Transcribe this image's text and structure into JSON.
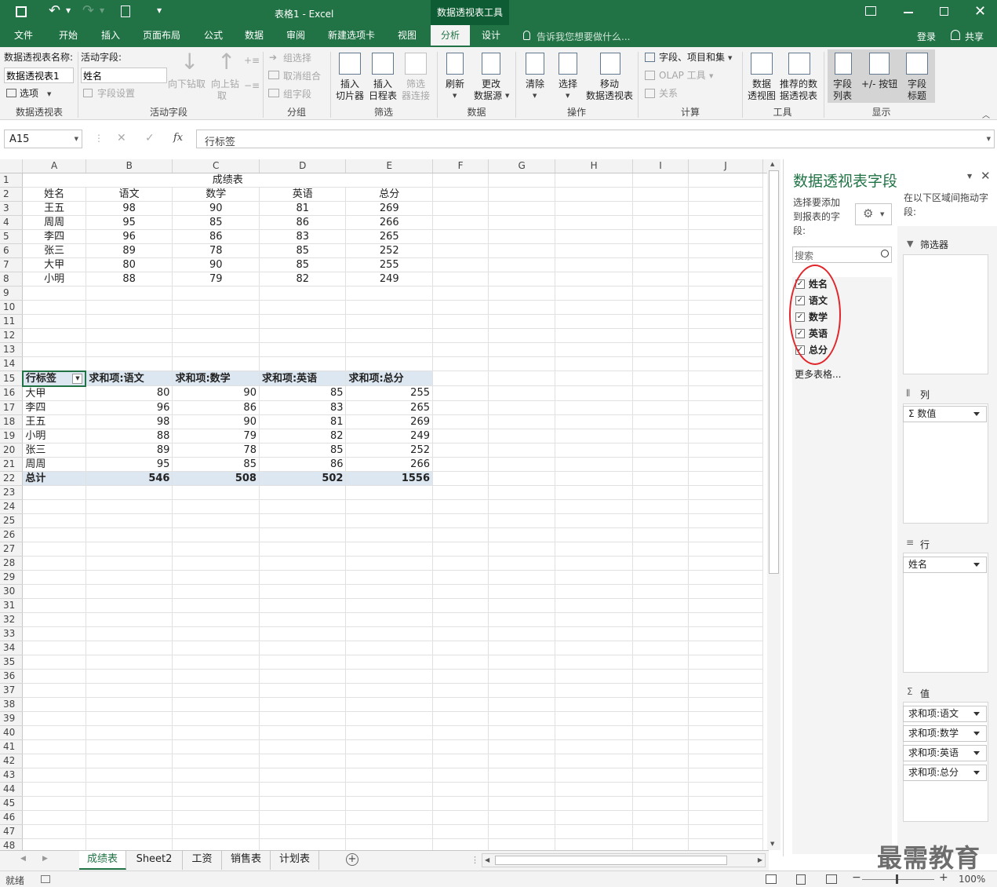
{
  "title": {
    "doc": "表格1 - Excel",
    "context_tool": "数据透视表工具"
  },
  "tabs": [
    "文件",
    "开始",
    "插入",
    "页面布局",
    "公式",
    "数据",
    "审阅",
    "新建选项卡",
    "视图",
    "分析",
    "设计"
  ],
  "tellme": "告诉我您想要做什么...",
  "login": "登录",
  "share": "共享",
  "ribbon": {
    "pt_name_label": "数据透视表名称:",
    "pt_name_value": "数据透视表1",
    "options": "选项",
    "active_field_label": "活动字段:",
    "active_field_value": "姓名",
    "field_settings": "字段设置",
    "drill_down": "向下钻取",
    "drill_up": "向上钻",
    "drill_up2": "取",
    "group_select": "组选择",
    "ungroup": "取消组合",
    "group_field": "组字段",
    "insert_slicer": [
      "插入",
      "切片器"
    ],
    "insert_timeline": [
      "插入",
      "日程表"
    ],
    "filter_conn": [
      "筛选",
      "器连接"
    ],
    "refresh": "刷新",
    "change_source": [
      "更改",
      "数据源"
    ],
    "clear": "清除",
    "select": "选择",
    "move_pt": [
      "移动",
      "数据透视表"
    ],
    "fields_items_sets": "字段、项目和集",
    "olap_tools": "OLAP 工具",
    "relationships": "关系",
    "pivotchart": [
      "数据",
      "透视图"
    ],
    "recommended_pt": [
      "推荐的数",
      "据透视表"
    ],
    "field_list": [
      "字段",
      "列表"
    ],
    "plus_minus_buttons": "+/- 按钮",
    "field_headers": [
      "字段",
      "标题"
    ],
    "groups": {
      "pivot_table": "数据透视表",
      "active_field": "活动字段",
      "group": "分组",
      "filter": "筛选",
      "data": "数据",
      "actions": "操作",
      "calculations": "计算",
      "tools": "工具",
      "show": "显示"
    }
  },
  "formula_bar": {
    "name_box": "A15",
    "content": "行标签"
  },
  "columns": [
    "A",
    "B",
    "C",
    "D",
    "E",
    "F",
    "G",
    "H",
    "I",
    "J"
  ],
  "source_table": {
    "title": "成绩表",
    "headers": [
      "姓名",
      "语文",
      "数学",
      "英语",
      "总分"
    ],
    "rows": [
      [
        "王五",
        "98",
        "90",
        "81",
        "269"
      ],
      [
        "周周",
        "95",
        "85",
        "86",
        "266"
      ],
      [
        "李四",
        "96",
        "86",
        "83",
        "265"
      ],
      [
        "张三",
        "89",
        "78",
        "85",
        "252"
      ],
      [
        "大甲",
        "80",
        "90",
        "85",
        "255"
      ],
      [
        "小明",
        "88",
        "79",
        "82",
        "249"
      ]
    ]
  },
  "pivot": {
    "headers": [
      "行标签",
      "求和项:语文",
      "求和项:数学",
      "求和项:英语",
      "求和项:总分"
    ],
    "rows": [
      [
        "大甲",
        "80",
        "90",
        "85",
        "255"
      ],
      [
        "李四",
        "96",
        "86",
        "83",
        "265"
      ],
      [
        "王五",
        "98",
        "90",
        "81",
        "269"
      ],
      [
        "小明",
        "88",
        "79",
        "82",
        "249"
      ],
      [
        "张三",
        "89",
        "78",
        "85",
        "252"
      ],
      [
        "周周",
        "95",
        "85",
        "86",
        "266"
      ]
    ],
    "total": [
      "总计",
      "546",
      "508",
      "502",
      "1556"
    ]
  },
  "sheet_tabs": [
    "成绩表",
    "Sheet2",
    "工资",
    "销售表",
    "计划表"
  ],
  "field_panel": {
    "title": "数据透视表字段",
    "choose_label": "选择要添加到报表的字段:",
    "drag_label": "在以下区域间拖动字段:",
    "search_placeholder": "搜索",
    "fields": [
      "姓名",
      "语文",
      "数学",
      "英语",
      "总分"
    ],
    "more_tables": "更多表格...",
    "filters_label": "筛选器",
    "columns_label": "列",
    "columns_item": "Σ 数值",
    "rows_label": "行",
    "rows_item": "姓名",
    "values_label": "值",
    "values_items": [
      "求和项:语文",
      "求和项:数学",
      "求和项:英语",
      "求和项:总分"
    ]
  },
  "status": {
    "ready": "就绪",
    "zoom": "100%"
  },
  "watermark": "最需教育",
  "colors": {
    "excel_green": "#217346",
    "pivot_header": "#dde7f1",
    "annotation_red": "#e0262b"
  }
}
